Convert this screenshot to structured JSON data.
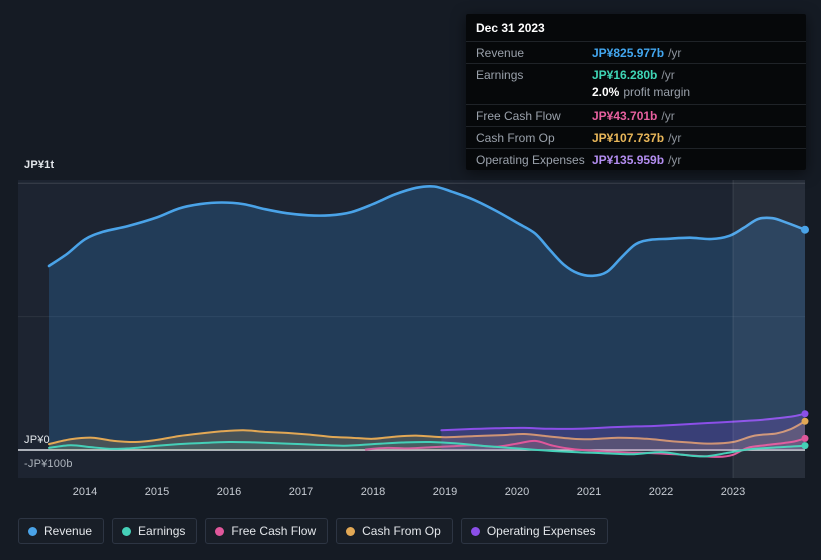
{
  "tooltip": {
    "date": "Dec 31 2023",
    "rows": [
      {
        "label": "Revenue",
        "value": "JP¥825.977b",
        "suffix": "/yr"
      },
      {
        "label": "Earnings",
        "value": "JP¥16.280b",
        "suffix": "/yr",
        "extra_value": "2.0%",
        "extra_label": "profit margin"
      },
      {
        "label": "Free Cash Flow",
        "value": "JP¥43.701b",
        "suffix": "/yr"
      },
      {
        "label": "Cash From Op",
        "value": "JP¥107.737b",
        "suffix": "/yr"
      },
      {
        "label": "Operating Expenses",
        "value": "JP¥135.959b",
        "suffix": "/yr"
      }
    ]
  },
  "legend": {
    "items": [
      {
        "label": "Revenue"
      },
      {
        "label": "Earnings"
      },
      {
        "label": "Free Cash Flow"
      },
      {
        "label": "Cash From Op"
      },
      {
        "label": "Operating Expenses"
      }
    ]
  },
  "chart_data": {
    "type": "area",
    "title": "Earnings and Revenue History",
    "y_unit": "JP¥ billions per year",
    "x_range": [
      2013.5,
      2024
    ],
    "x_ticks": [
      2014,
      2015,
      2016,
      2017,
      2018,
      2019,
      2020,
      2021,
      2022,
      2023
    ],
    "y_ticks": [
      {
        "label": "JP¥1t",
        "value": 1000
      },
      {
        "label": "JP¥0",
        "value": 0
      },
      {
        "label": "-JP¥100b",
        "value": -100
      }
    ],
    "gridline_values": [
      1000,
      500
    ],
    "highlight_from_year": 2023,
    "colors": {
      "background": "#151b24",
      "plot_background": "#1d2431",
      "zero_line": "#dde2e8"
    },
    "series": [
      {
        "name": "Revenue",
        "color": "#4aa3e8",
        "tooltip_color": "#43a7f0",
        "fill": "rgba(47,124,195,0.27)",
        "width": 2.6,
        "dot": 4,
        "points": [
          [
            2013.5,
            690
          ],
          [
            2013.75,
            735
          ],
          [
            2014,
            790
          ],
          [
            2014.25,
            818
          ],
          [
            2014.6,
            840
          ],
          [
            2015,
            872
          ],
          [
            2015.3,
            905
          ],
          [
            2015.6,
            922
          ],
          [
            2015.9,
            928
          ],
          [
            2016.2,
            922
          ],
          [
            2016.5,
            903
          ],
          [
            2016.8,
            888
          ],
          [
            2017.1,
            880
          ],
          [
            2017.4,
            880
          ],
          [
            2017.7,
            892
          ],
          [
            2018,
            922
          ],
          [
            2018.3,
            958
          ],
          [
            2018.6,
            983
          ],
          [
            2018.85,
            988
          ],
          [
            2019.1,
            968
          ],
          [
            2019.4,
            938
          ],
          [
            2019.7,
            898
          ],
          [
            2020,
            852
          ],
          [
            2020.25,
            812
          ],
          [
            2020.45,
            752
          ],
          [
            2020.65,
            695
          ],
          [
            2020.85,
            662
          ],
          [
            2021.05,
            653
          ],
          [
            2021.25,
            668
          ],
          [
            2021.45,
            722
          ],
          [
            2021.65,
            772
          ],
          [
            2021.85,
            788
          ],
          [
            2022.1,
            792
          ],
          [
            2022.4,
            796
          ],
          [
            2022.7,
            791
          ],
          [
            2022.95,
            803
          ],
          [
            2023.15,
            833
          ],
          [
            2023.35,
            866
          ],
          [
            2023.55,
            869
          ],
          [
            2023.75,
            852
          ],
          [
            2024,
            826
          ]
        ]
      },
      {
        "name": "Earnings",
        "color": "#45d0b8",
        "tooltip_color": "#3fd6b6",
        "fill": "rgba(69,208,184,0.10)",
        "width": 2,
        "dot": 3.5,
        "points": [
          [
            2013.5,
            8
          ],
          [
            2013.8,
            18
          ],
          [
            2014.1,
            10
          ],
          [
            2014.4,
            4
          ],
          [
            2014.7,
            8
          ],
          [
            2015,
            16
          ],
          [
            2015.3,
            22
          ],
          [
            2015.6,
            26
          ],
          [
            2016,
            30
          ],
          [
            2016.4,
            28
          ],
          [
            2016.8,
            24
          ],
          [
            2017.2,
            20
          ],
          [
            2017.6,
            16
          ],
          [
            2018,
            22
          ],
          [
            2018.4,
            28
          ],
          [
            2018.8,
            30
          ],
          [
            2019.2,
            24
          ],
          [
            2019.6,
            14
          ],
          [
            2020,
            6
          ],
          [
            2020.4,
            -2
          ],
          [
            2020.8,
            -8
          ],
          [
            2021.2,
            -12
          ],
          [
            2021.6,
            -16
          ],
          [
            2022,
            -8
          ],
          [
            2022.3,
            -18
          ],
          [
            2022.6,
            -24
          ],
          [
            2022.9,
            -12
          ],
          [
            2023.2,
            2
          ],
          [
            2023.5,
            8
          ],
          [
            2023.75,
            12
          ],
          [
            2024,
            16.28
          ]
        ]
      },
      {
        "name": "Free Cash Flow",
        "color": "#e0579b",
        "tooltip_color": "#e7609f",
        "fill": "rgba(224,87,155,0.10)",
        "width": 2,
        "dot": 3.5,
        "points": [
          [
            2017.9,
            2
          ],
          [
            2018.2,
            8
          ],
          [
            2018.5,
            6
          ],
          [
            2018.8,
            10
          ],
          [
            2019.1,
            14
          ],
          [
            2019.4,
            18
          ],
          [
            2019.7,
            12
          ],
          [
            2020,
            24
          ],
          [
            2020.25,
            34
          ],
          [
            2020.5,
            16
          ],
          [
            2020.75,
            4
          ],
          [
            2021,
            -2
          ],
          [
            2021.3,
            -6
          ],
          [
            2021.6,
            -10
          ],
          [
            2021.9,
            -12
          ],
          [
            2022.2,
            -16
          ],
          [
            2022.5,
            -22
          ],
          [
            2022.8,
            -26
          ],
          [
            2023,
            -18
          ],
          [
            2023.2,
            8
          ],
          [
            2023.45,
            18
          ],
          [
            2023.7,
            26
          ],
          [
            2023.85,
            32
          ],
          [
            2024,
            43.7
          ]
        ]
      },
      {
        "name": "Cash From Op",
        "color": "#e2a855",
        "tooltip_color": "#e9b75a",
        "fill": "rgba(226,168,85,0.20)",
        "width": 2,
        "dot": 3.5,
        "points": [
          [
            2013.5,
            22
          ],
          [
            2013.8,
            40
          ],
          [
            2014.1,
            46
          ],
          [
            2014.4,
            34
          ],
          [
            2014.7,
            30
          ],
          [
            2015,
            38
          ],
          [
            2015.3,
            52
          ],
          [
            2015.6,
            62
          ],
          [
            2015.9,
            70
          ],
          [
            2016.2,
            74
          ],
          [
            2016.5,
            68
          ],
          [
            2016.8,
            64
          ],
          [
            2017.1,
            58
          ],
          [
            2017.4,
            50
          ],
          [
            2017.7,
            46
          ],
          [
            2018,
            42
          ],
          [
            2018.3,
            50
          ],
          [
            2018.6,
            54
          ],
          [
            2019,
            48
          ],
          [
            2019.4,
            52
          ],
          [
            2019.8,
            56
          ],
          [
            2020.1,
            60
          ],
          [
            2020.4,
            52
          ],
          [
            2020.7,
            44
          ],
          [
            2021,
            40
          ],
          [
            2021.4,
            46
          ],
          [
            2021.8,
            42
          ],
          [
            2022.1,
            34
          ],
          [
            2022.4,
            28
          ],
          [
            2022.7,
            24
          ],
          [
            2023,
            30
          ],
          [
            2023.3,
            54
          ],
          [
            2023.6,
            62
          ],
          [
            2023.8,
            78
          ],
          [
            2024,
            107.74
          ]
        ]
      },
      {
        "name": "Operating Expenses",
        "color": "#8b4fe8",
        "tooltip_color": "#b38df0",
        "fill": "rgba(139,79,232,0.22)",
        "width": 2,
        "dot": 3.5,
        "points": [
          [
            2018.95,
            74
          ],
          [
            2019.2,
            77
          ],
          [
            2019.5,
            80
          ],
          [
            2019.8,
            82
          ],
          [
            2020.1,
            83
          ],
          [
            2020.4,
            80
          ],
          [
            2020.7,
            79
          ],
          [
            2021,
            81
          ],
          [
            2021.3,
            85
          ],
          [
            2021.6,
            88
          ],
          [
            2021.9,
            90
          ],
          [
            2022.2,
            94
          ],
          [
            2022.5,
            99
          ],
          [
            2022.8,
            103
          ],
          [
            2023.1,
            108
          ],
          [
            2023.4,
            113
          ],
          [
            2023.65,
            120
          ],
          [
            2023.85,
            127
          ],
          [
            2024,
            135.96
          ]
        ]
      }
    ]
  }
}
